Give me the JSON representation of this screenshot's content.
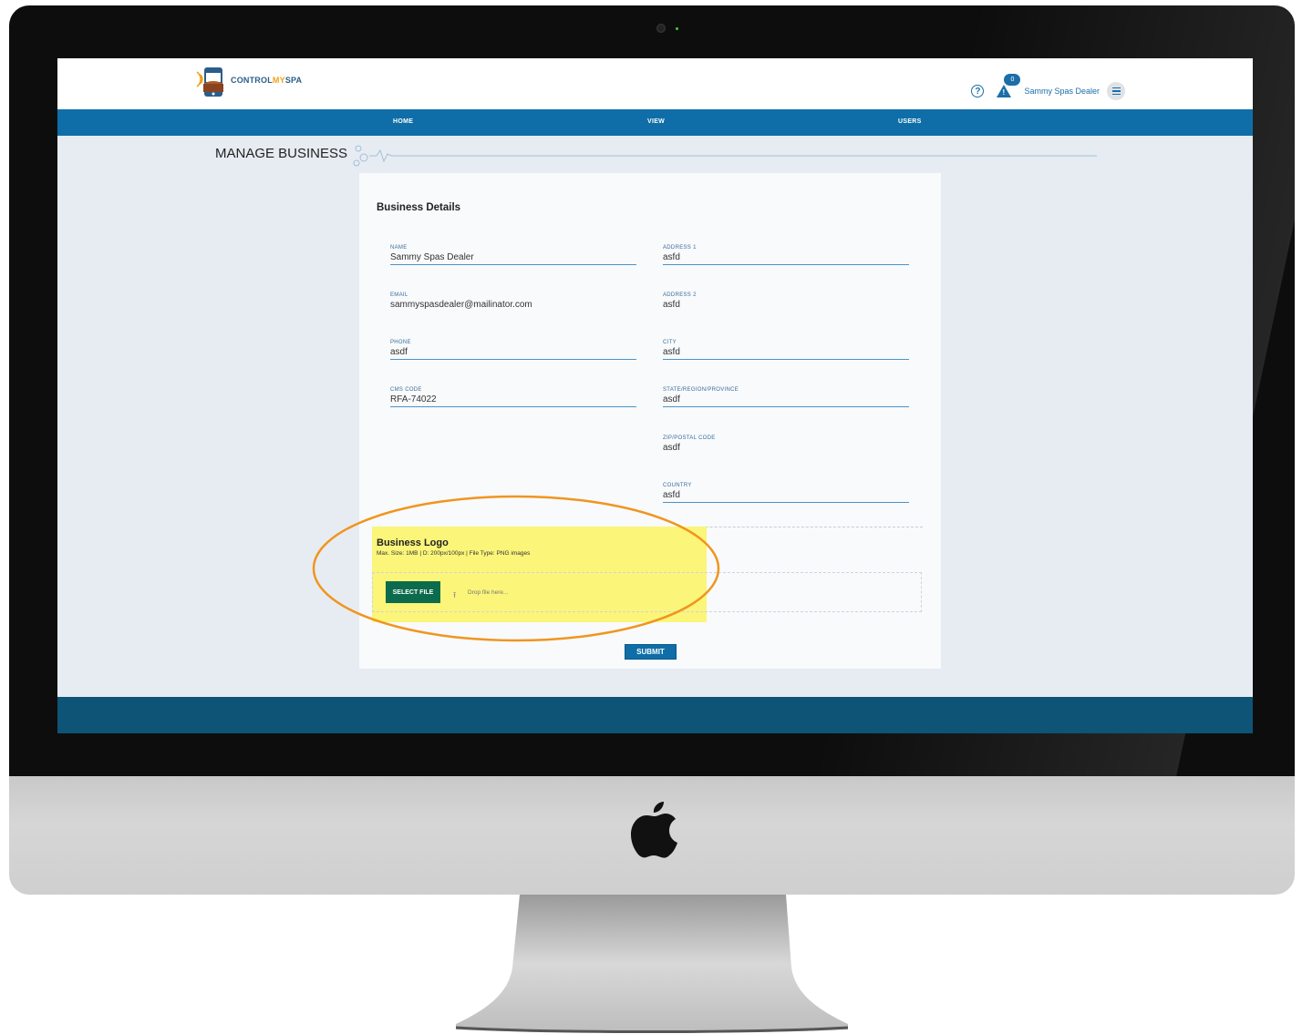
{
  "brand": {
    "name_part1": "CONTROL",
    "name_part2": "MY",
    "name_part3": "SPA"
  },
  "header": {
    "user_name": "Sammy Spas Dealer",
    "notification_count": "0"
  },
  "nav": {
    "items": [
      "HOME",
      "VIEW",
      "USERS"
    ]
  },
  "page": {
    "title": "MANAGE BUSINESS"
  },
  "form": {
    "section_title": "Business Details",
    "fields": {
      "name": {
        "label": "NAME",
        "value": "Sammy Spas Dealer"
      },
      "email": {
        "label": "EMAIL",
        "value": "sammyspasdealer@mailinator.com"
      },
      "phone": {
        "label": "PHONE",
        "value": "asdf"
      },
      "cms_code": {
        "label": "CMS CODE",
        "value": "RFA-74022"
      },
      "address1": {
        "label": "ADDRESS 1",
        "value": "asfd"
      },
      "address2": {
        "label": "ADDRESS 2",
        "value": "asfd"
      },
      "city": {
        "label": "CITY",
        "value": "asfd"
      },
      "state": {
        "label": "STATE/REGION/PROVINCE",
        "value": "asdf"
      },
      "zip": {
        "label": "ZIP/POSTAL CODE",
        "value": "asdf"
      },
      "country": {
        "label": "COUNTRY",
        "value": "asfd"
      }
    },
    "logo": {
      "title": "Business Logo",
      "hint": "Max. Size: 1MB | D: 200px/100px | File Type: PNG images",
      "select_label": "SELECT FILE",
      "drop_text": "Drop file here..."
    },
    "submit_label": "SUBMIT"
  },
  "colors": {
    "nav_blue": "#0f6ea8",
    "footer": "#0d5476",
    "select_green": "#0d6b4d",
    "highlight_yellow": "#fbf57a",
    "callout_orange": "#f0951e"
  }
}
